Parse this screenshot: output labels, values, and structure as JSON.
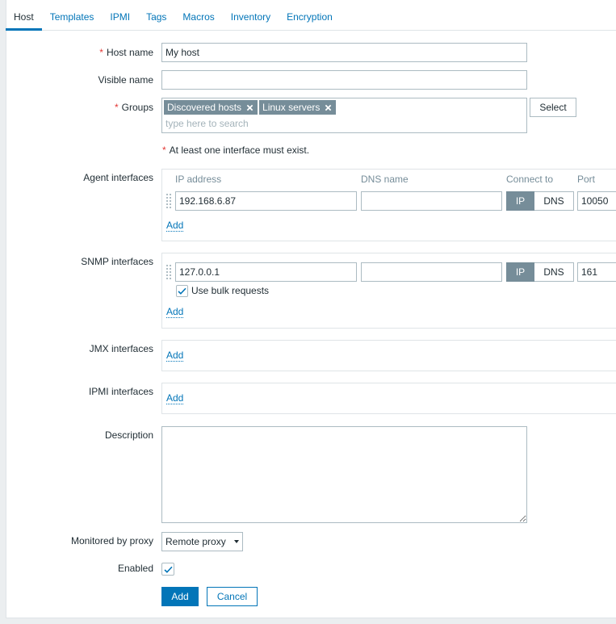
{
  "tabs": {
    "items": [
      "Host",
      "Templates",
      "IPMI",
      "Tags",
      "Macros",
      "Inventory",
      "Encryption"
    ],
    "active_index": 0
  },
  "required_mark": "*",
  "host_name": {
    "label": "Host name",
    "value": "My host"
  },
  "visible_name": {
    "label": "Visible name",
    "value": ""
  },
  "groups": {
    "label": "Groups",
    "selected": [
      "Discovered hosts",
      "Linux servers"
    ],
    "placeholder": "type here to search",
    "select_button": "Select"
  },
  "interfaces_notice": "At least one interface must exist.",
  "agent_interfaces": {
    "label": "Agent interfaces",
    "columns": {
      "ip": "IP address",
      "dns": "DNS name",
      "connect": "Connect to",
      "port": "Port"
    },
    "rows": [
      {
        "ip": "192.168.6.87",
        "dns": "",
        "connect_options": [
          "IP",
          "DNS"
        ],
        "connect_active_index": 0,
        "port": "10050"
      }
    ],
    "add_link": "Add"
  },
  "snmp_interfaces": {
    "label": "SNMP interfaces",
    "rows": [
      {
        "ip": "127.0.0.1",
        "dns": "",
        "connect_options": [
          "IP",
          "DNS"
        ],
        "connect_active_index": 0,
        "port": "161",
        "bulk_label": "Use bulk requests",
        "bulk_checked": true
      }
    ],
    "add_link": "Add"
  },
  "jmx_interfaces": {
    "label": "JMX interfaces",
    "add_link": "Add"
  },
  "ipmi_interfaces": {
    "label": "IPMI interfaces",
    "add_link": "Add"
  },
  "description": {
    "label": "Description",
    "value": ""
  },
  "proxy": {
    "label": "Monitored by proxy",
    "selected": "Remote proxy"
  },
  "enabled": {
    "label": "Enabled",
    "checked": true
  },
  "actions": {
    "add": "Add",
    "cancel": "Cancel"
  },
  "icons": {
    "chip_remove": "remove-icon",
    "drag": "drag-handle-icon",
    "checkbox": "check-icon",
    "dropdown": "chevron-down-icon"
  },
  "colors": {
    "text": "#1f2c33",
    "link": "#0275b8",
    "chip": "#768d99",
    "muted": "#768d99",
    "required": "#e33734",
    "input_border": "#acbbc2",
    "border": "#dfe4e7",
    "page_bg": "#ebeef0"
  }
}
